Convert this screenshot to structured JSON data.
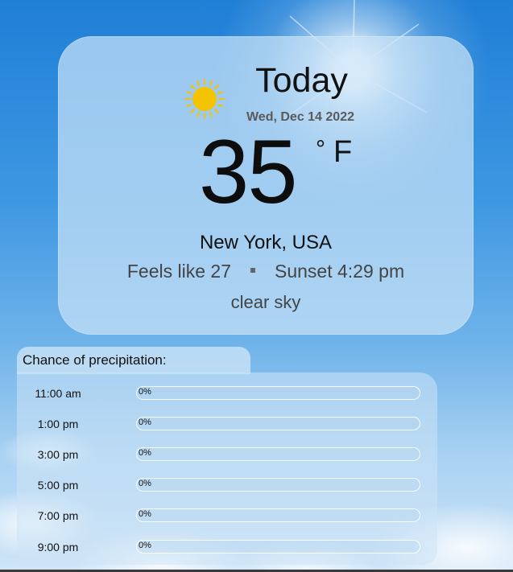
{
  "weather": {
    "day_label": "Today",
    "date": "Wed, Dec 14 2022",
    "temperature": "35",
    "degree_symbol": "°",
    "unit": "F",
    "location": "New York, USA",
    "feels_like": "Feels like 27",
    "sunset": "Sunset 4:29 pm",
    "description": "clear sky",
    "icon": "sun-icon"
  },
  "precipitation": {
    "title": "Chance of precipitation:",
    "rows": [
      {
        "time": "11:00 am",
        "percent": "0%",
        "value": 0
      },
      {
        "time": "1:00 pm",
        "percent": "0%",
        "value": 0
      },
      {
        "time": "3:00 pm",
        "percent": "0%",
        "value": 0
      },
      {
        "time": "5:00 pm",
        "percent": "0%",
        "value": 0
      },
      {
        "time": "7:00 pm",
        "percent": "0%",
        "value": 0
      },
      {
        "time": "9:00 pm",
        "percent": "0%",
        "value": 0
      }
    ]
  },
  "colors": {
    "sun": "#f5c400",
    "sky_top": "#1f7fd6",
    "card_bg": "#c8e2f6"
  }
}
